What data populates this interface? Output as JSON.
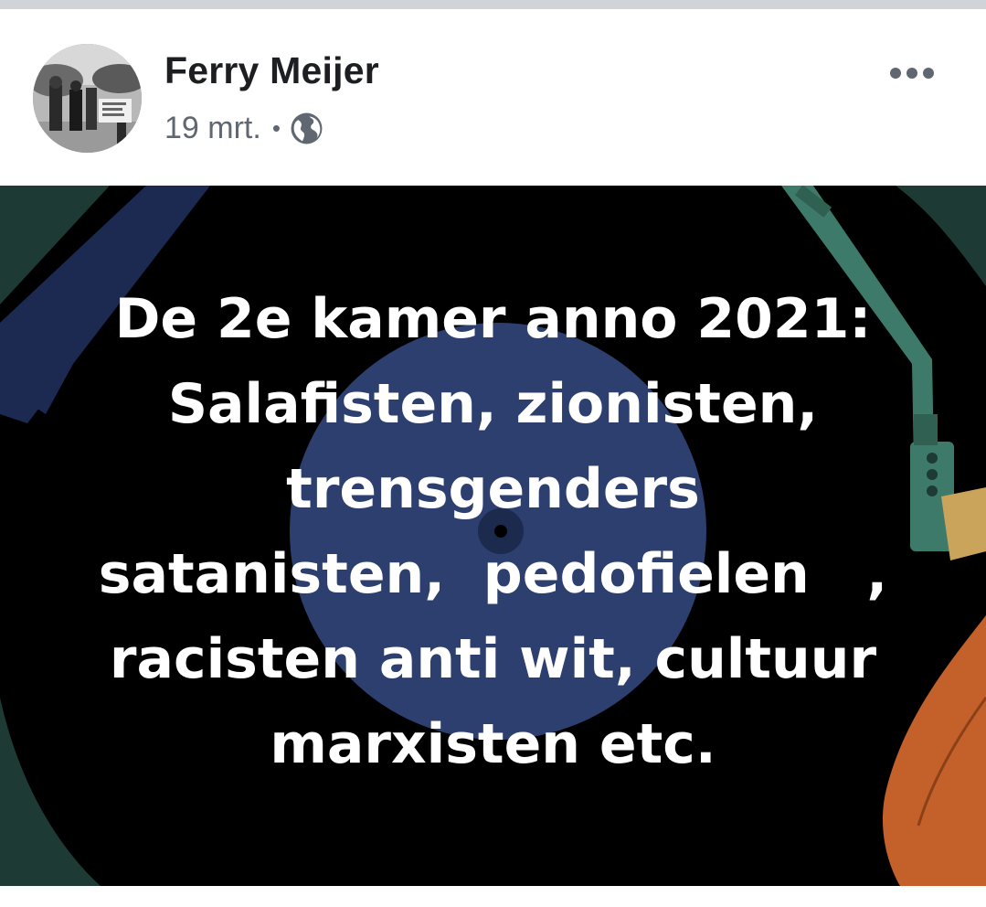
{
  "post": {
    "author": "Ferry Meijer",
    "date": "19 mrt.",
    "separator": "•",
    "audience_icon": "globe-icon",
    "options_icon": "more-options-icon"
  },
  "image": {
    "caption_lines": [
      "De 2e kamer anno 2021:",
      "Salafisten, zionisten,",
      "trensgenders",
      "satanisten,  pedofielen   ,",
      "racisten anti wit, cultuur",
      "marxisten etc."
    ]
  },
  "colors": {
    "background": "#000000",
    "record": "#2c3f6e",
    "teal": "#3d7a6a",
    "orange": "#c4602a",
    "dark_green": "#1e3a34"
  }
}
